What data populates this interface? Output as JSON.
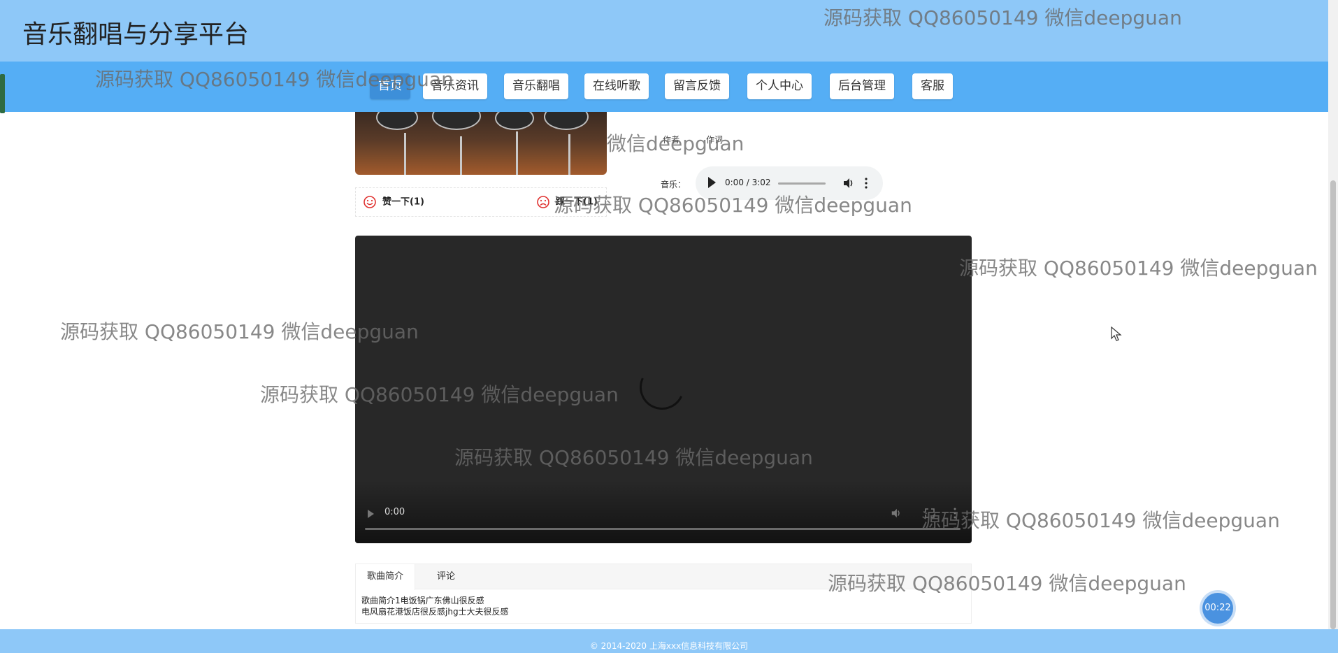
{
  "header": {
    "site_title": "音乐翻唱与分享平台"
  },
  "nav": {
    "items": [
      {
        "label": "首页"
      },
      {
        "label": "音乐资讯"
      },
      {
        "label": "音乐翻唱"
      },
      {
        "label": "在线听歌"
      },
      {
        "label": "留言反馈"
      },
      {
        "label": "个人中心"
      },
      {
        "label": "后台管理"
      },
      {
        "label": "客服"
      }
    ],
    "active_index": 0
  },
  "song_meta": {
    "label_1": "作者",
    "label_2": "作词"
  },
  "vote": {
    "like_label": "赞一下(1)",
    "dislike_label": "踩一下(1)"
  },
  "audio": {
    "label": "音乐：",
    "time": "0:00 / 3:02"
  },
  "video": {
    "time": "0:00"
  },
  "tabs": {
    "items": [
      {
        "label": "歌曲简介"
      },
      {
        "label": "评论"
      }
    ],
    "active_index": 0,
    "content_line_1": "歌曲简介1电饭锅广东佛山很反感",
    "content_line_2": "电风扇花港饭店很反感jhg士大夫很反感"
  },
  "footer": {
    "copyright": "© 2014-2020 上海xxx信息科技有限公司"
  },
  "timer": {
    "value": "00:22"
  },
  "watermark": {
    "text": "源码获取 QQ86050149 微信deepguan",
    "partial_text": "微信deepguan"
  },
  "colors": {
    "header_bg": "#8ec8f8",
    "nav_bg": "#55aef5",
    "nav_active_bg": "#3d8fd9",
    "footer_bg": "#8ec8f8",
    "icon_red": "#e0312f",
    "timer_bg": "#4a92e0"
  },
  "icons": {
    "like": "smile-face-icon",
    "dislike": "frown-face-icon"
  }
}
